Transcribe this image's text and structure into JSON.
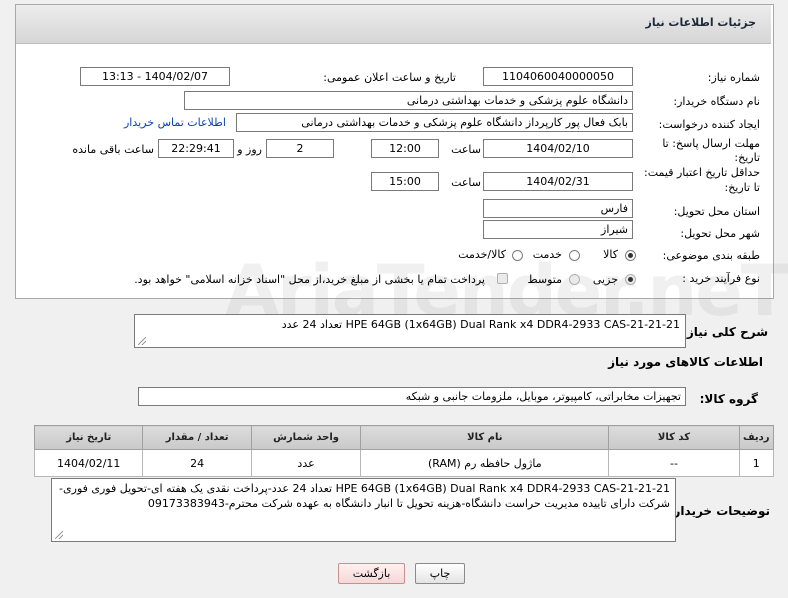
{
  "panel": {
    "title": "جزئیات اطلاعات نیاز"
  },
  "form": {
    "need_number": {
      "label": "شماره نیاز:",
      "value": "1104060040000050"
    },
    "announce": {
      "label": "تاریخ و ساعت اعلان عمومی:",
      "value": "1404/02/07 - 13:13"
    },
    "buyer_org": {
      "label": "نام دستگاه خریدار:",
      "value": "دانشگاه علوم پزشکی و خدمات بهداشتی درمانی"
    },
    "creator": {
      "label": "ایجاد کننده درخواست:",
      "value": "بابک فعال پور کارپرداز دانشگاه علوم پزشکی و خدمات بهداشتی درمانی",
      "contact_link": "اطلاعات تماس خریدار"
    },
    "deadline": {
      "label_line1": "مهلت ارسال پاسخ: تا",
      "label_line2": "تاریخ:",
      "date": "1404/02/10",
      "time_label": "ساعت",
      "time": "12:00",
      "days": "2",
      "days_label": "روز و",
      "remaining": "22:29:41",
      "remaining_label": "ساعت باقی مانده"
    },
    "price_validity": {
      "label_line1": "حداقل تاریخ اعتبار قیمت:",
      "label_line2": "تا تاریخ:",
      "date": "1404/02/31",
      "time_label": "ساعت",
      "time": "15:00"
    },
    "province": {
      "label": "استان محل تحویل:",
      "value": "فارس"
    },
    "city": {
      "label": "شهر محل تحویل:",
      "value": "شیراز"
    },
    "category": {
      "label": "طبقه بندی موضوعی:",
      "options": [
        "کالا",
        "خدمت",
        "کالا/خدمت"
      ]
    },
    "process": {
      "label": "نوع فرآیند خرید :",
      "options": [
        "جزیی",
        "متوسط"
      ],
      "payment_note": "پرداخت تمام یا بخشی از مبلغ خرید،از محل \"اسناد خزانه اسلامی\" خواهد بود."
    }
  },
  "general_desc": {
    "label": "شرح کلی نیاز:",
    "value": "HPE 64GB (1x64GB) Dual Rank x4 DDR4-2933 CAS-21-21-21 تعداد 24 عدد"
  },
  "goods_section": {
    "title": "اطلاعات کالاهای مورد نیاز"
  },
  "goods_group": {
    "label": "گروه کالا:",
    "value": "تجهیزات مخابراتی، کامپیوتر، موبایل، ملزومات جانبی و شبکه"
  },
  "table": {
    "headers": [
      "ردیف",
      "کد کالا",
      "نام کالا",
      "واحد شمارش",
      "تعداد / مقدار",
      "تاریخ نیاز"
    ],
    "rows": [
      [
        "1",
        "--",
        "ماژول حافظه رم (RAM)",
        "عدد",
        "24",
        "1404/02/11"
      ]
    ]
  },
  "buyer_notes": {
    "label": "توضیحات خریدار:",
    "value": "HPE 64GB (1x64GB) Dual Rank x4 DDR4-2933 CAS-21-21-21 تعداد 24 عدد-پرداخت نقدی یک هفته ای-تحویل فوری فوری-شرکت دارای تاییده مدیریت حراست دانشگاه-هزینه تحویل تا انبار دانشگاه به عهده شرکت محترم-09173383943"
  },
  "buttons": {
    "print": "چاپ",
    "back": "بازگشت"
  },
  "watermark": "AriaTender.neT"
}
